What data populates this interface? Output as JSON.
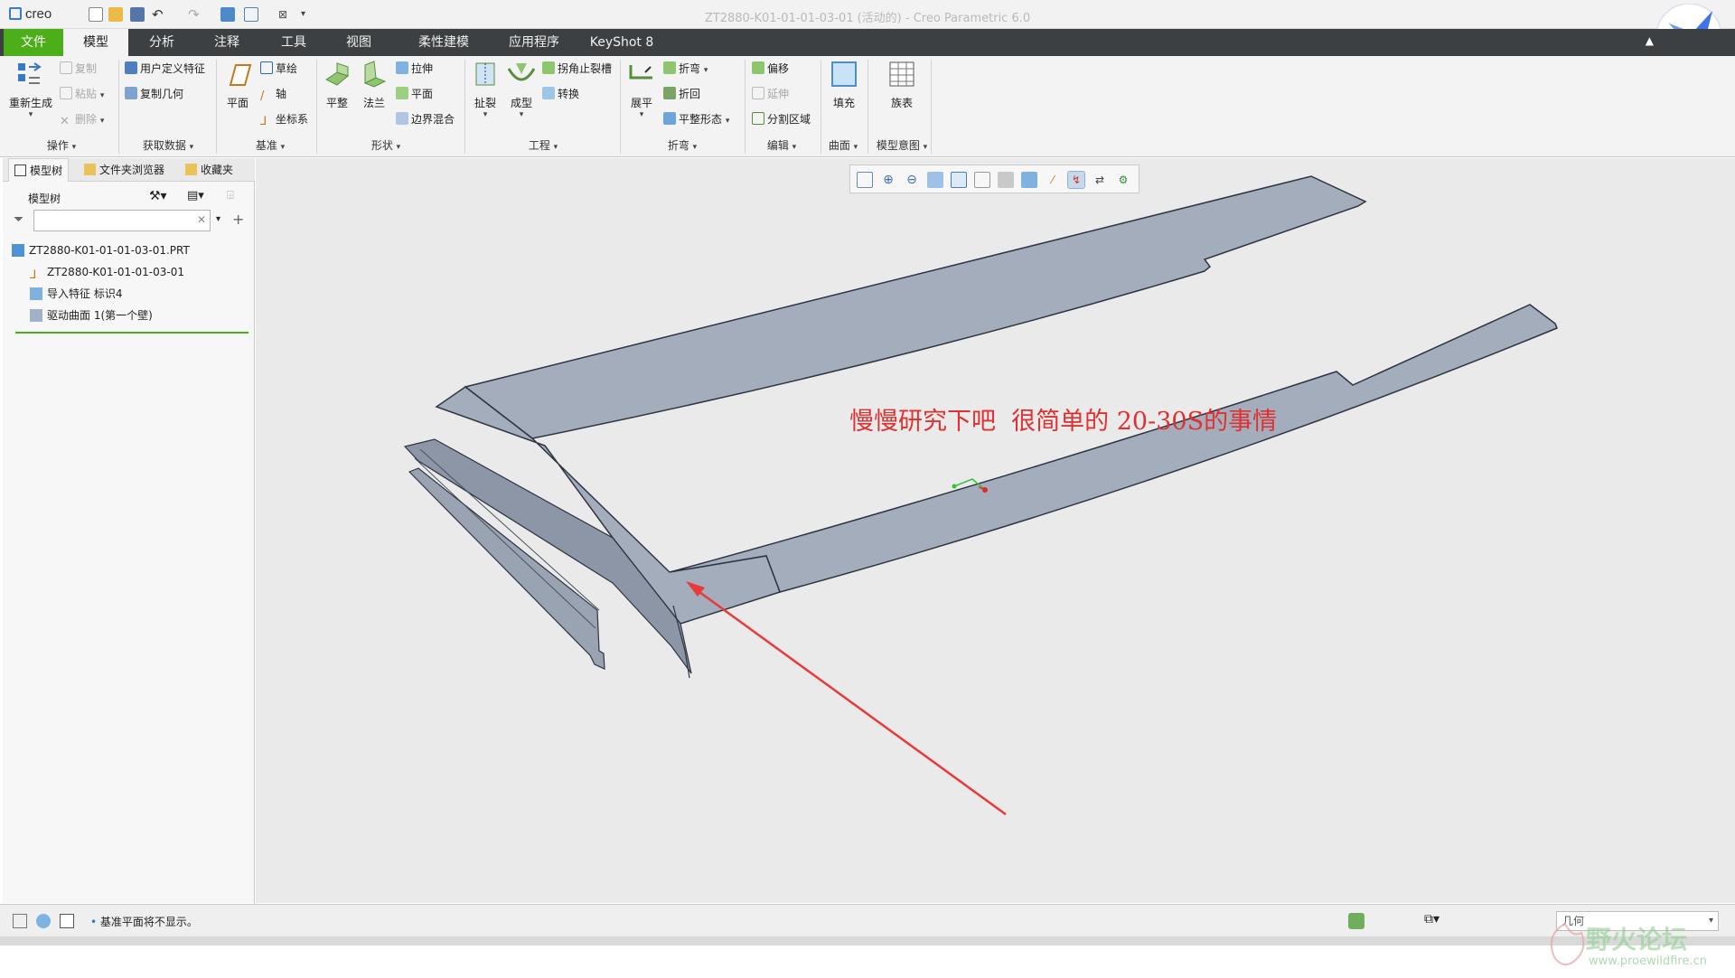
{
  "app": {
    "logo_text": "creo",
    "window_title": "ZT2880-K01-01-01-03-01 (活动的) - Creo Parametric 6.0"
  },
  "tabs": [
    {
      "label": "文件"
    },
    {
      "label": "模型"
    },
    {
      "label": "分析"
    },
    {
      "label": "注释"
    },
    {
      "label": "工具"
    },
    {
      "label": "视图"
    },
    {
      "label": "柔性建模"
    },
    {
      "label": "应用程序"
    },
    {
      "label": "KeyShot 8"
    }
  ],
  "ribbon": {
    "operations": {
      "label": "操作",
      "regenerate": "重新生成",
      "copy": "复制",
      "paste": "粘贴",
      "delete": "删除"
    },
    "get_data": {
      "label": "获取数据",
      "user_defined_feature": "用户定义特征",
      "copy_geometry": "复制几何"
    },
    "datum": {
      "label": "基准",
      "plane": "平面",
      "sketch": "草绘",
      "axis": "轴",
      "csys": "坐标系"
    },
    "shapes": {
      "label": "形状",
      "flat": "平整",
      "flange": "法兰",
      "extrude": "拉伸",
      "planar": "平面",
      "boundary_blend": "边界混合"
    },
    "engineering": {
      "label": "工程",
      "rip": "扯裂",
      "form": "成型",
      "corner_relief": "拐角止裂槽",
      "convert": "转换"
    },
    "bends": {
      "label": "折弯",
      "unbend": "展平",
      "bend": "折弯",
      "bend_back": "折回",
      "flatten_form": "平整形态"
    },
    "editing": {
      "label": "编辑",
      "offset": "偏移",
      "extend": "延伸",
      "split_area": "分割区域"
    },
    "surfaces": {
      "label": "曲面",
      "fill": "填充"
    },
    "model_intent": {
      "label": "模型意图",
      "family_table": "族表"
    }
  },
  "left_panel": {
    "tabs": [
      "模型树",
      "文件夹浏览器",
      "收藏夹"
    ],
    "header": "模型树",
    "search_value": "",
    "tree": [
      "ZT2880-K01-01-01-03-01.PRT",
      "ZT2880-K01-01-01-03-01",
      "导入特征 标识4",
      "驱动曲面 1(第一个壁)"
    ]
  },
  "graphics": {
    "annotation": "慢慢研究下吧  很简单的 20-30S的事情",
    "annotation_color": "#e03030",
    "arrow_color": "#e83a3a",
    "part_color": "#a3adbb"
  },
  "status": {
    "message": "基准平面将不显示。",
    "filter_value": "几何"
  },
  "watermark": {
    "text": "野火论坛",
    "url": "www.proewildfire.cn"
  }
}
